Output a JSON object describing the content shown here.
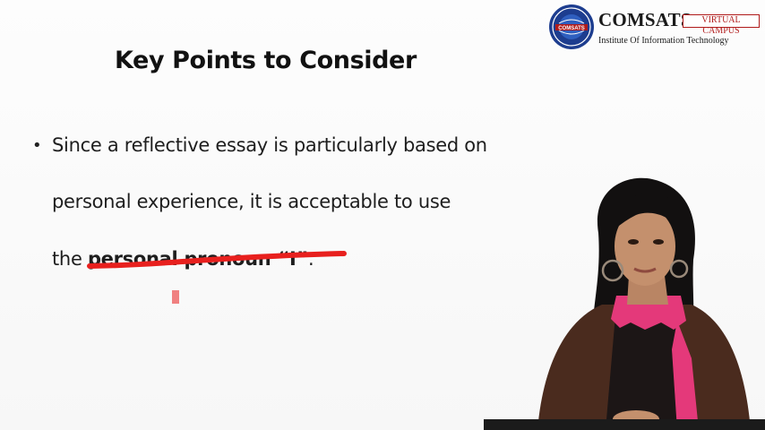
{
  "logo": {
    "name": "COMSATS",
    "tag": "VIRTUAL CAMPUS",
    "subtitle": "Institute Of Information Technology",
    "seal_text": "COMSATS"
  },
  "slide": {
    "title": "Key Points to Consider",
    "bullet_marker": "•",
    "lines": [
      "Since a reflective essay is particularly based on",
      "personal experience, it is acceptable to use"
    ],
    "line3_prefix": "the ",
    "line3_highlight": "personal pronoun “I”",
    "line3_suffix": "."
  },
  "colors": {
    "annotation_red": "#e8201e",
    "logo_blue": "#1d3d8f",
    "logo_red": "#b01a1a"
  }
}
